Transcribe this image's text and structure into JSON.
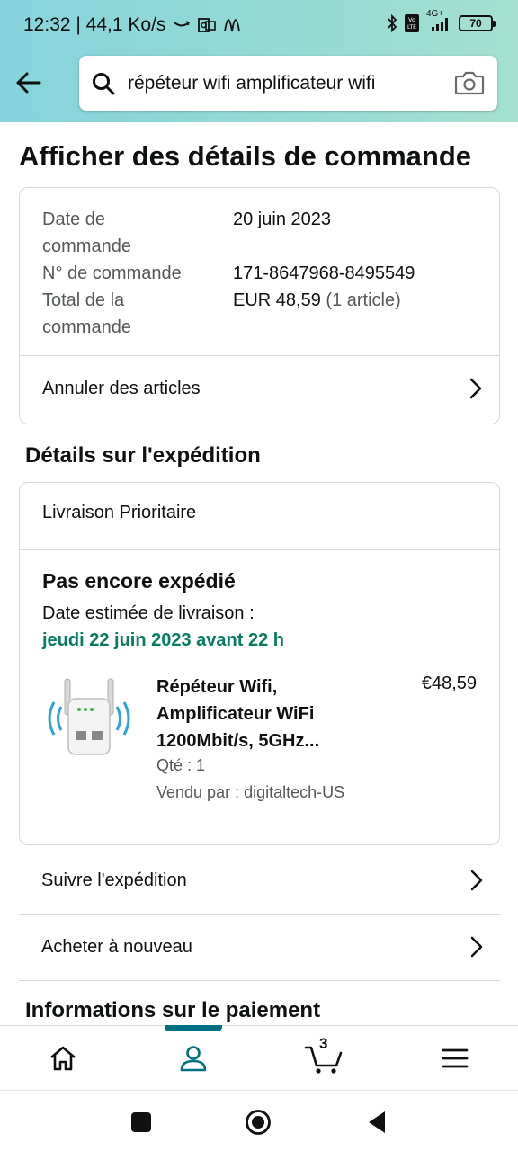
{
  "status_bar": {
    "time_speed": "12:32 | 44,1 Ko/s",
    "network": "4G+",
    "volte": "Vo LTE",
    "battery": "70"
  },
  "search": {
    "query": "répéteur wifi amplificateur wifi"
  },
  "page": {
    "title": "Afficher des détails de commande"
  },
  "order_summary": {
    "rows": [
      {
        "label": "Date de commande",
        "value": "20 juin 2023"
      },
      {
        "label": "N° de commande",
        "value": "171-8647968-8495549"
      },
      {
        "label": "Total de la commande",
        "value": "EUR 48,59",
        "value_extra": "(1 article)"
      }
    ],
    "cancel_label": "Annuler des articles"
  },
  "shipping": {
    "section_title": "Détails sur l'expédition",
    "method": "Livraison Prioritaire",
    "status": "Pas encore expédié",
    "eta_label": "Date estimée de livraison :",
    "eta_date": "jeudi 22 juin 2023 avant 22 h",
    "product": {
      "title": "Répéteur Wifi, Amplificateur WiFi 1200Mbit/s, 5GHz...",
      "price": "€48,59",
      "qty": "Qté : 1",
      "seller": "Vendu par : digitaltech-US"
    },
    "track_label": "Suivre l'expédition",
    "buy_again_label": "Acheter à nouveau"
  },
  "payment": {
    "section_title": "Informations sur le paiement"
  },
  "bottom_nav": {
    "cart_count": "3"
  },
  "colors": {
    "header_gradient_start": "#86d4dd",
    "header_gradient_end": "#a5e0cf",
    "eta_green": "#067d62",
    "nav_indicator": "#007185"
  }
}
